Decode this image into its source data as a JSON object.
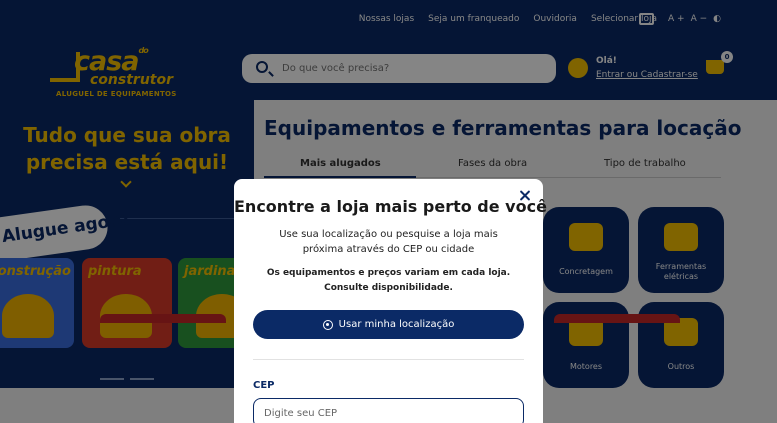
{
  "topbar": {
    "links": [
      "Nossas lojas",
      "Seja um franqueado",
      "Ouvidoria",
      "Selecionar loja"
    ],
    "font_controls": [
      "A +",
      "A −"
    ]
  },
  "header": {
    "logo": {
      "main": "casa",
      "small": "do",
      "second": "construtor",
      "tagline": "ALUGUEL DE EQUIPAMENTOS"
    },
    "search": {
      "placeholder": "Do que você precisa?"
    },
    "account": {
      "greeting": "Olá!",
      "link": "Entrar ou Cadastrar-se"
    },
    "cart": {
      "count": "0"
    }
  },
  "hero": {
    "title": "Tudo que sua obra precisa está aqui!",
    "pill": "Alugue agora",
    "cards": [
      "construção",
      "pintura",
      "jardinagem"
    ]
  },
  "content": {
    "title": "Equipamentos e ferramentas para locação",
    "tabs": [
      "Mais alugados",
      "Fases da obra",
      "Tipo de trabalho"
    ],
    "categories": [
      "Concretagem",
      "Ferramentas elétricas",
      "Motores",
      "Outros"
    ]
  },
  "modal": {
    "title": "Encontre a loja mais perto de você",
    "description": "Use sua localização ou pesquise a loja mais próxima através do CEP ou cidade",
    "note": "Os equipamentos e preços variam em cada loja. Consulte disponibilidade.",
    "location_button": "Usar minha localização",
    "cep_label": "CEP",
    "cep_placeholder": "Digite seu CEP"
  },
  "colors": {
    "brand_blue": "#0b2a66",
    "brand_yellow": "#f6c000"
  }
}
